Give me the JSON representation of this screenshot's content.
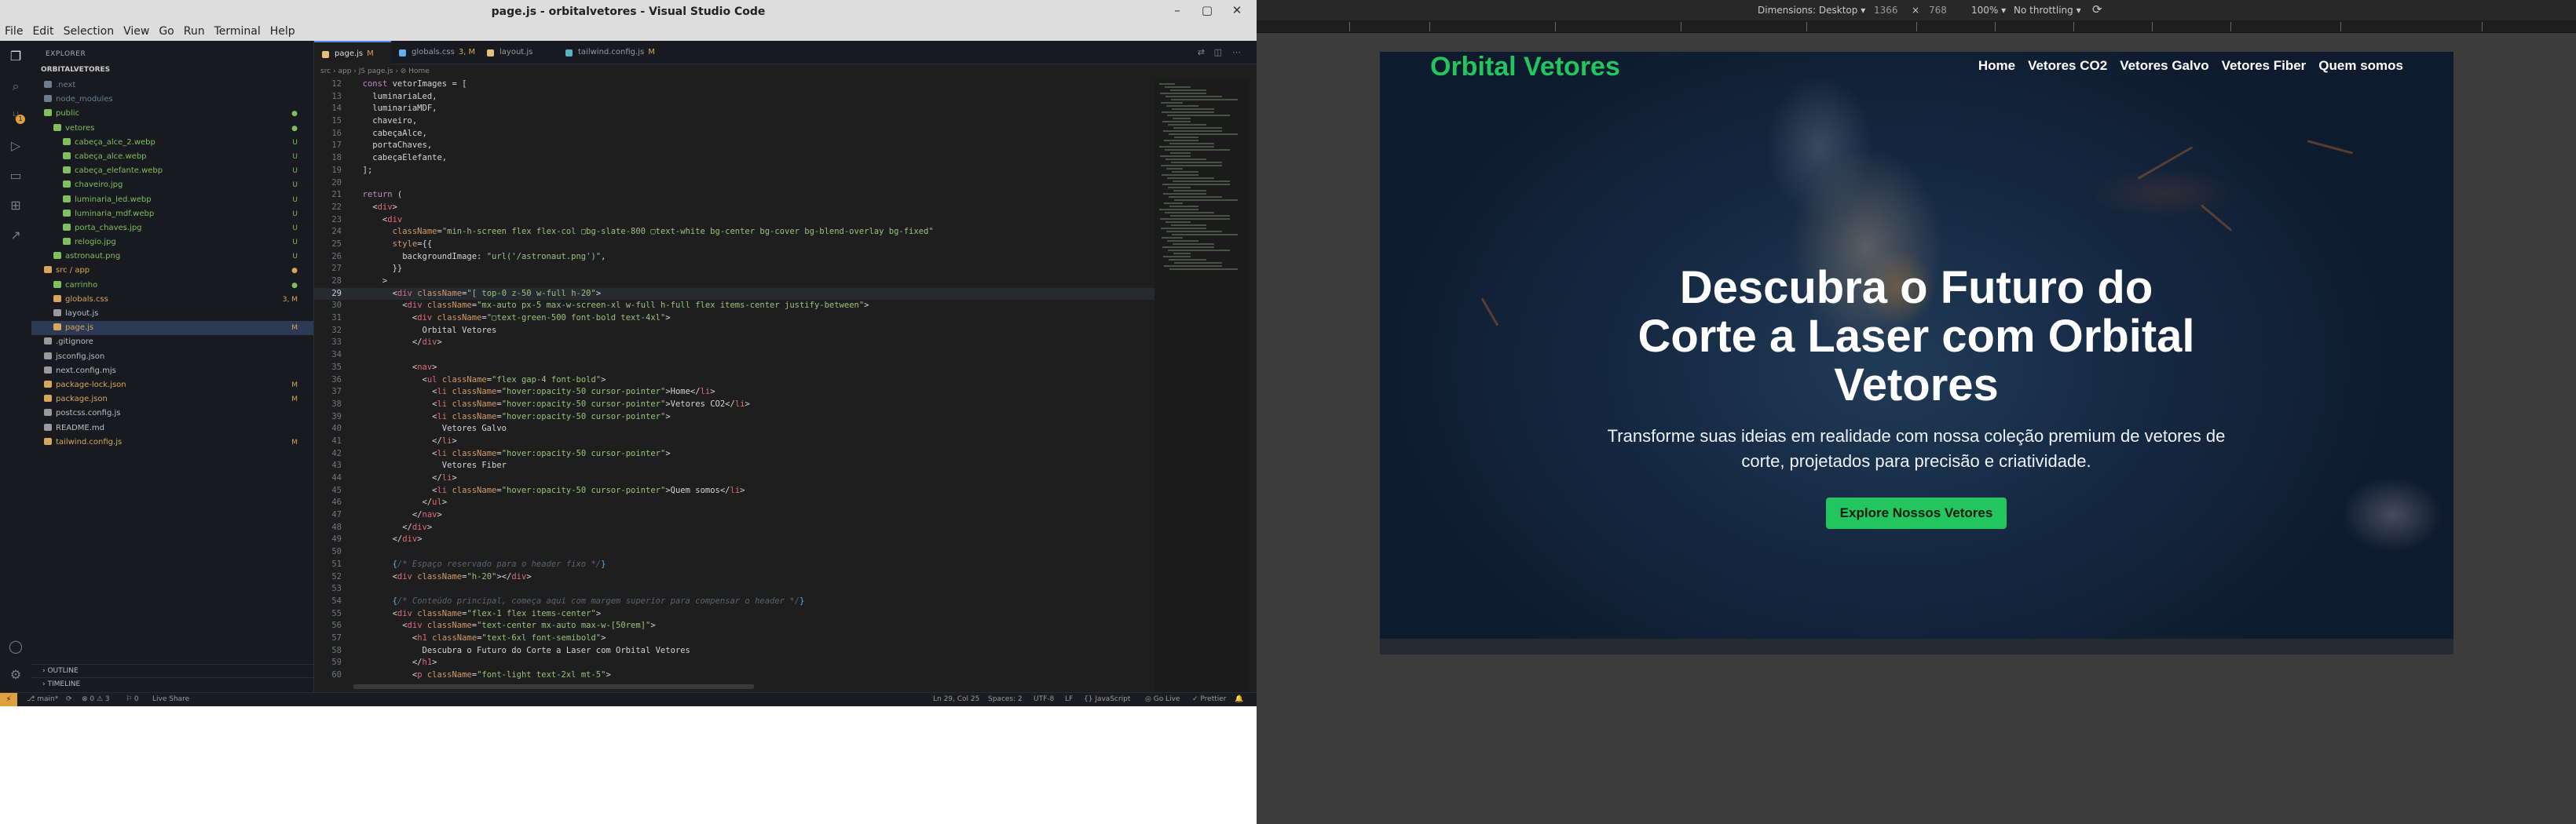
{
  "window": {
    "title": "page.js - orbitalvetores - Visual Studio Code",
    "controls": [
      "–",
      "▢",
      "✕"
    ]
  },
  "menu": [
    "File",
    "Edit",
    "Selection",
    "View",
    "Go",
    "Run",
    "Terminal",
    "Help"
  ],
  "explorer": {
    "header": "EXPLORER",
    "project": "ORBITALVETORES",
    "items": [
      {
        "label": ".next",
        "color": "#6d7d8d",
        "status": ""
      },
      {
        "label": "node_modules",
        "color": "#6d7d8d",
        "status": ""
      },
      {
        "label": "public",
        "color": "#7fbf5f",
        "status": "●"
      },
      {
        "label": "vetores",
        "color": "#7fbf5f",
        "status": "●"
      },
      {
        "label": "cabeça_alce_2.webp",
        "color": "#7fbf5f",
        "status": "U"
      },
      {
        "label": "cabeça_alce.webp",
        "color": "#7fbf5f",
        "status": "U"
      },
      {
        "label": "cabeça_elefante.webp",
        "color": "#7fbf5f",
        "status": "U"
      },
      {
        "label": "chaveiro.jpg",
        "color": "#7fbf5f",
        "status": "U"
      },
      {
        "label": "luminaria_led.webp",
        "color": "#7fbf5f",
        "status": "U"
      },
      {
        "label": "luminaria_mdf.webp",
        "color": "#7fbf5f",
        "status": "U"
      },
      {
        "label": "porta_chaves.jpg",
        "color": "#7fbf5f",
        "status": "U"
      },
      {
        "label": "relogio.jpg",
        "color": "#7fbf5f",
        "status": "U"
      },
      {
        "label": "astronaut.png",
        "color": "#7fbf5f",
        "status": "U"
      },
      {
        "label": "src / app",
        "color": "#d7a65a",
        "status": "●"
      },
      {
        "label": "carrinho",
        "color": "#7fbf5f",
        "status": "●"
      },
      {
        "label": "globals.css",
        "color": "#d7a65a",
        "status": "3, M"
      },
      {
        "label": "layout.js",
        "color": "#9a9a9a",
        "status": ""
      },
      {
        "label": "page.js",
        "color": "#d7a65a",
        "status": "M"
      },
      {
        "label": ".gitignore",
        "color": "#9a9a9a",
        "status": ""
      },
      {
        "label": "jsconfig.json",
        "color": "#9a9a9a",
        "status": ""
      },
      {
        "label": "next.config.mjs",
        "color": "#9a9a9a",
        "status": ""
      },
      {
        "label": "package-lock.json",
        "color": "#d7a65a",
        "status": "M"
      },
      {
        "label": "package.json",
        "color": "#d7a65a",
        "status": "M"
      },
      {
        "label": "postcss.config.js",
        "color": "#9a9a9a",
        "status": ""
      },
      {
        "label": "README.md",
        "color": "#9a9a9a",
        "status": ""
      },
      {
        "label": "tailwind.config.js",
        "color": "#d7a65a",
        "status": "M"
      }
    ],
    "outline": "OUTLINE",
    "timeline": "TIMELINE"
  },
  "tabs": [
    {
      "label": "page.js",
      "mark": "M",
      "icon": "#e5c07b"
    },
    {
      "label": "globals.css",
      "mark": "3, M",
      "icon": "#61afef"
    },
    {
      "label": "layout.js",
      "mark": "",
      "icon": "#e5c07b"
    },
    {
      "label": "tailwind.config.js",
      "mark": "M",
      "icon": "#56b6c2"
    }
  ],
  "breadcrumb": "src › app › JS page.js › ⊘ Home",
  "code": [
    {
      "n": "12",
      "html": "  <span class='k'>const</span> <span class='v'>vetorImages</span> = ["
    },
    {
      "n": "13",
      "html": "    luminariaLed,"
    },
    {
      "n": "14",
      "html": "    luminariaMDF,"
    },
    {
      "n": "15",
      "html": "    chaveiro,"
    },
    {
      "n": "16",
      "html": "    cabeçaAlce,"
    },
    {
      "n": "17",
      "html": "    portaChaves,"
    },
    {
      "n": "18",
      "html": "    cabeçaElefante,"
    },
    {
      "n": "19",
      "html": "  ];"
    },
    {
      "n": "20",
      "html": ""
    },
    {
      "n": "21",
      "html": "  <span class='k'>return</span> ("
    },
    {
      "n": "22",
      "html": "    &lt;<span class='t'>div</span>&gt;"
    },
    {
      "n": "23",
      "html": "      &lt;<span class='t'>div</span>"
    },
    {
      "n": "24",
      "html": "        <span class='a'>className</span>=<span class='s'>\"min-h-screen flex flex-col ▢bg-slate-800 ▢text-white bg-center bg-cover bg-blend-overlay bg-fixed\"</span>"
    },
    {
      "n": "25",
      "html": "        <span class='a'>style</span>={{"
    },
    {
      "n": "26",
      "html": "          backgroundImage: <span class='s'>\"url('/astronaut.png')\"</span>,"
    },
    {
      "n": "27",
      "html": "        }}"
    },
    {
      "n": "28",
      "html": "      &gt;"
    },
    {
      "n": "29",
      "html": "        &lt;<span class='t'>div</span> <span class='a'>className</span>=<span class='s'>\"[ top-0 z-50 w-full h-20\"</span>&gt;",
      "cur": true
    },
    {
      "n": "30",
      "html": "          &lt;<span class='t'>div</span> <span class='a'>className</span>=<span class='s'>\"mx-auto px-5 max-w-screen-xl w-full h-full flex items-center justify-between\"</span>&gt;"
    },
    {
      "n": "31",
      "html": "            &lt;<span class='t'>div</span> <span class='a'>className</span>=<span class='s'>\"▢text-green-500 font-bold text-4xl\"</span>&gt;"
    },
    {
      "n": "32",
      "html": "              Orbital Vetores"
    },
    {
      "n": "33",
      "html": "            &lt;/<span class='t'>div</span>&gt;"
    },
    {
      "n": "34",
      "html": ""
    },
    {
      "n": "35",
      "html": "            &lt;<span class='t'>nav</span>&gt;"
    },
    {
      "n": "36",
      "html": "              &lt;<span class='t'>ul</span> <span class='a'>className</span>=<span class='s'>\"flex gap-4 font-bold\"</span>&gt;"
    },
    {
      "n": "37",
      "html": "                &lt;<span class='t'>li</span> <span class='a'>className</span>=<span class='s'>\"hover:opacity-50 cursor-pointer\"</span>&gt;Home&lt;/<span class='t'>li</span>&gt;"
    },
    {
      "n": "38",
      "html": "                &lt;<span class='t'>li</span> <span class='a'>className</span>=<span class='s'>\"hover:opacity-50 cursor-pointer\"</span>&gt;Vetores CO2&lt;/<span class='t'>li</span>&gt;"
    },
    {
      "n": "39",
      "html": "                &lt;<span class='t'>li</span> <span class='a'>className</span>=<span class='s'>\"hover:opacity-50 cursor-pointer\"</span>&gt;"
    },
    {
      "n": "40",
      "html": "                  Vetores Galvo"
    },
    {
      "n": "41",
      "html": "                &lt;/<span class='t'>li</span>&gt;"
    },
    {
      "n": "42",
      "html": "                &lt;<span class='t'>li</span> <span class='a'>className</span>=<span class='s'>\"hover:opacity-50 cursor-pointer\"</span>&gt;"
    },
    {
      "n": "43",
      "html": "                  Vetores Fiber"
    },
    {
      "n": "44",
      "html": "                &lt;/<span class='t'>li</span>&gt;"
    },
    {
      "n": "45",
      "html": "                &lt;<span class='t'>li</span> <span class='a'>className</span>=<span class='s'>\"hover:opacity-50 cursor-pointer\"</span>&gt;Quem somos&lt;/<span class='t'>li</span>&gt;"
    },
    {
      "n": "46",
      "html": "              &lt;/<span class='t'>ul</span>&gt;"
    },
    {
      "n": "47",
      "html": "            &lt;/<span class='t'>nav</span>&gt;"
    },
    {
      "n": "48",
      "html": "          &lt;/<span class='t'>div</span>&gt;"
    },
    {
      "n": "49",
      "html": "        &lt;/<span class='t'>div</span>&gt;"
    },
    {
      "n": "50",
      "html": ""
    },
    {
      "n": "51",
      "html": "        <span class='f'>{</span><span class='c'>/* Espaço reservado para o header fixo */</span><span class='f'>}</span>"
    },
    {
      "n": "52",
      "html": "        &lt;<span class='t'>div</span> <span class='a'>className</span>=<span class='s'>\"h-20\"</span>&gt;&lt;/<span class='t'>div</span>&gt;"
    },
    {
      "n": "53",
      "html": ""
    },
    {
      "n": "54",
      "html": "        <span class='f'>{</span><span class='c'>/* Conteúdo principal, começa aqui com margem superior para compensar o header */</span><span class='f'>}</span>"
    },
    {
      "n": "55",
      "html": "        &lt;<span class='t'>div</span> <span class='a'>className</span>=<span class='s'>\"flex-1 flex items-center\"</span>&gt;"
    },
    {
      "n": "56",
      "html": "          &lt;<span class='t'>div</span> <span class='a'>className</span>=<span class='s'>\"text-center mx-auto max-w-[50rem]\"</span>&gt;"
    },
    {
      "n": "57",
      "html": "            &lt;<span class='t'>h1</span> <span class='a'>className</span>=<span class='s'>\"text-6xl font-semibold\"</span>&gt;"
    },
    {
      "n": "58",
      "html": "              Descubra o Futuro do Corte a Laser com Orbital Vetores"
    },
    {
      "n": "59",
      "html": "            &lt;/<span class='t'>h1</span>&gt;"
    },
    {
      "n": "60",
      "html": "            &lt;<span class='t'>p</span> <span class='a'>className</span>=<span class='s'>\"font-light text-2xl mt-5\"</span>&gt;"
    }
  ],
  "statusbar": {
    "remote": "⚡",
    "branch": "⎇ main*",
    "sync": "⟳",
    "problems": "⊗ 0  ⚠ 3",
    "ports": "⚐ 0",
    "live_share": "Live Share",
    "position": "Ln 29, Col 25",
    "spaces": "Spaces: 2",
    "encoding": "UTF-8",
    "eol": "LF",
    "language": "{} JavaScript",
    "golive": "◎ Go Live",
    "prettier": "✓ Prettier",
    "bell": "🔔"
  },
  "devtools": {
    "dimensions": "Dimensions: Desktop ▾",
    "width": "1366",
    "times": "×",
    "height": "768",
    "zoom": "100% ▾",
    "throttle": "No throttling ▾"
  },
  "site": {
    "logo": "Orbital Vetores",
    "nav": [
      "Home",
      "Vetores CO2",
      "Vetores Galvo",
      "Vetores Fiber",
      "Quem somos"
    ],
    "hero_title": "Descubra o Futuro do Corte a Laser com Orbital Vetores",
    "hero_subtitle": "Transforme suas ideias em realidade com nossa coleção premium de vetores de corte, projetados para precisão e criatividade.",
    "cta": "Explore Nossos Vetores",
    "brand_color": "#22c55e"
  }
}
